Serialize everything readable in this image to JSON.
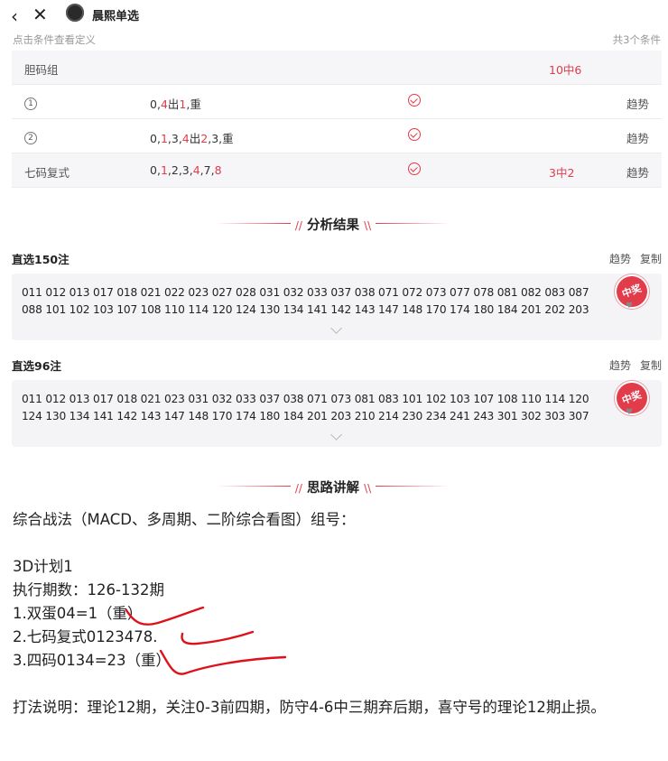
{
  "topbar": {
    "back_icon": "back-icon",
    "close_icon": "close-icon",
    "app_name": "晨熙单选"
  },
  "hint": "点击条件查看定义",
  "count": "共3个条件",
  "conditions": {
    "header": {
      "name": "胆码组",
      "hit": "10中6"
    },
    "rows": [
      {
        "name_glyph": "1",
        "values": [
          "0,",
          "4",
          "出",
          "1",
          ",重"
        ],
        "trend": "趋势",
        "hit": ""
      },
      {
        "name_glyph": "2",
        "values": [
          "0,",
          "1",
          ",3,",
          "4",
          "出",
          "2",
          ",3,重"
        ],
        "trend": "趋势",
        "hit": ""
      },
      {
        "name": "七码复式",
        "values": [
          "0,",
          "1",
          ",2,3,",
          "4",
          ",7,",
          "8"
        ],
        "trend": "趋势",
        "hit": "3中2"
      }
    ]
  },
  "analysis": {
    "title": "分析结果",
    "groups": [
      {
        "label": "直选150注",
        "trend": "趋势",
        "copy": "复制",
        "stamp": "中奖",
        "line1": "011 012 013 017 018 021 022 023 027 028 031 032 033 037 038 071 072 073 077 078 081 082 083 087",
        "line2": "088 101 102 103 107 108 110 114 120 124 130 134 141 142 143 147 148 170 174 180 184 201 202 203"
      },
      {
        "label": "直选96注",
        "trend": "趋势",
        "copy": "复制",
        "stamp": "中奖",
        "line1": "011 012 013 017 018 021 023 031 032 033 037 038 071 073 081 083 101 102 103 107 108 110 114 120",
        "line2": "124 130 134 141 142 143 147 148 170 174 180 184 201 203 210 214 230 234 241 243 301 302 303 307"
      }
    ]
  },
  "explain": {
    "title": "思路讲解",
    "intro": "综合战法（MACD、多周期、二阶综合看图）组号：",
    "plan": "3D计划1",
    "period": "执行期数：126-132期",
    "item1": "1.双蛋04=1（重）",
    "item2": "2.七码复式0123478.",
    "item3": "3.四码0134=23（重）",
    "notes": "打法说明：理论12期，关注0-3前四期，防守4-6中三期弃后期，喜守号的理论12期止损。"
  },
  "colors": {
    "accent": "#e23b4a",
    "scribble": "#e0101a"
  }
}
